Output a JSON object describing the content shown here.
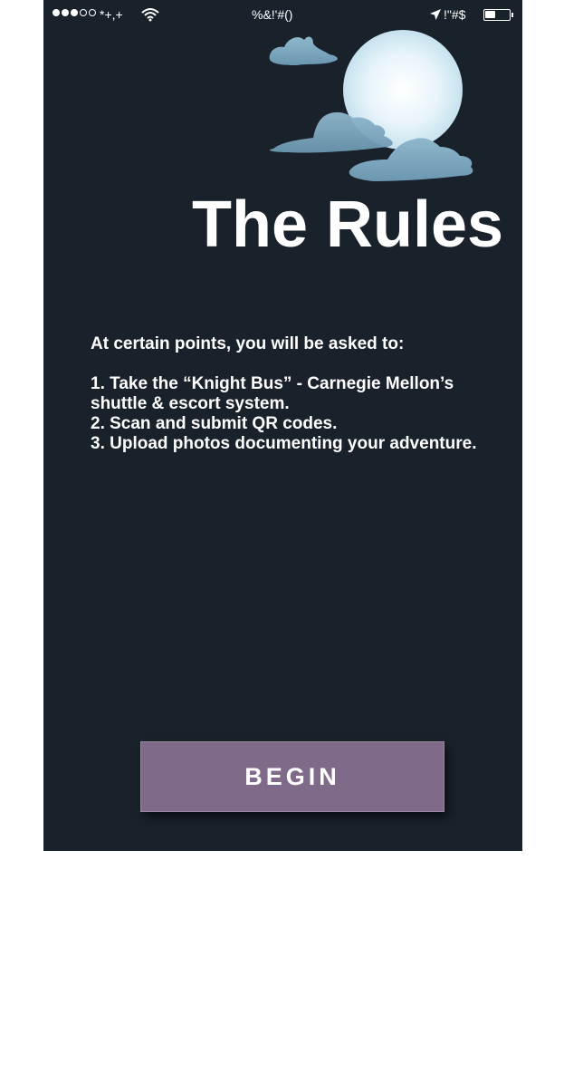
{
  "status_bar": {
    "signal_dots": [
      "full",
      "full",
      "full",
      "empty",
      "empty"
    ],
    "carrier": "*+,+",
    "time": "%&!'#()",
    "right_text": "!\"#$",
    "battery_level": 0.45,
    "icons": [
      "wifi-icon",
      "location-arrow-icon",
      "battery-icon"
    ]
  },
  "header": {
    "title": "The Rules",
    "illustration": [
      "moon",
      "clouds"
    ]
  },
  "rules": {
    "intro": "At certain points, you will be asked to:",
    "items": [
      "1. Take the “Knight Bus” - Carnegie Mellon’s shuttle & escort system.",
      "2. Scan and submit QR codes.",
      "3. Upload photos documenting your adventure."
    ]
  },
  "actions": {
    "begin_label": "BEGIN"
  },
  "colors": {
    "background": "#19222b",
    "button": "#7f6a89",
    "text": "#ffffff",
    "cloud": "#7aa4bc",
    "moon": "#dff0f7"
  }
}
